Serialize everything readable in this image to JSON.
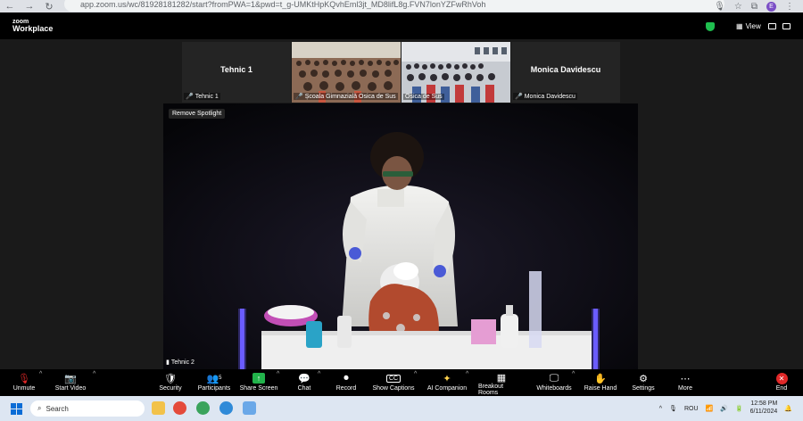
{
  "browser": {
    "url": "app.zoom.us/wc/81928181282/start?fromPWA=1&pwd=t_g-UMKtHpKQvhEml3jt_MD8lifL8g.FVN7lonYZFwRhVoh",
    "profile_initial": "E"
  },
  "header": {
    "brand_top": "zoom",
    "brand_bottom": "Workplace",
    "view_label": "View"
  },
  "gallery": [
    {
      "title": "Tehnic 1",
      "label": "Tehnic 1",
      "type": "name"
    },
    {
      "title": "",
      "label": "Școala Gimnazială Osica de Sus",
      "type": "video"
    },
    {
      "title": "",
      "label": "Osica de Sus",
      "type": "video"
    },
    {
      "title": "Monica Davidescu",
      "label": "Monica Davidescu",
      "type": "name"
    }
  ],
  "spotlight": {
    "remove_label": "Remove Spotlight",
    "participant": "Tehnic 2"
  },
  "toolbar": {
    "unmute": "Unmute",
    "start_video": "Start Video",
    "security": "Security",
    "participants": "Participants",
    "participants_count": "5",
    "share_screen": "Share Screen",
    "chat": "Chat",
    "record": "Record",
    "captions": "Show Captions",
    "ai": "AI Companion",
    "breakout": "Breakout Rooms",
    "whiteboards": "Whiteboards",
    "raise_hand": "Raise Hand",
    "settings": "Settings",
    "more": "More",
    "end": "End"
  },
  "taskbar": {
    "search_placeholder": "Search",
    "language": "ROU",
    "time": "12:58 PM",
    "date": "6/11/2024"
  },
  "colors": {
    "accent_green": "#1fbf4f",
    "end_red": "#e02828",
    "share_green": "#22b34b"
  }
}
